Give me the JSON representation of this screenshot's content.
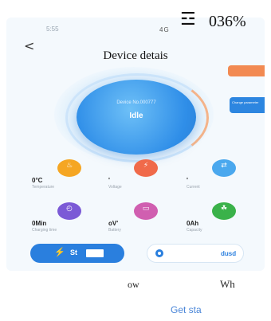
{
  "status": {
    "time": "5:55",
    "signal": "4G",
    "wifi_icon": "☲",
    "battery": "036%"
  },
  "nav": {
    "back": "<",
    "title": "Device   detais"
  },
  "device": {
    "name": "Device No.000777",
    "state": "Idle"
  },
  "side_tags": {
    "change": "Change parameter"
  },
  "metrics": [
    {
      "icon": "thermometer-icon",
      "glyph": "♨",
      "color": "#f5a623",
      "value": "0°C",
      "label": "Temperature"
    },
    {
      "icon": "voltage-icon",
      "glyph": "⚡",
      "color": "#f06a4a",
      "value": "'",
      "label": "Voltage"
    },
    {
      "icon": "current-icon",
      "glyph": "⇄",
      "color": "#4aa8ee",
      "value": "'",
      "label": "Current"
    },
    {
      "icon": "clock-icon",
      "glyph": "◴",
      "color": "#7b5ad6",
      "value": "0Min",
      "label": "Charging time"
    },
    {
      "icon": "battery-icon",
      "glyph": "▭",
      "color": "#d05fb0",
      "value": "oV'",
      "label": "Battery"
    },
    {
      "icon": "leaf-icon",
      "glyph": "☘",
      "color": "#3ab24a",
      "value": "0Ah",
      "label": "Capacity"
    }
  ],
  "buttons": {
    "start": "St",
    "stop": "dusd"
  },
  "readouts": {
    "power": "ow",
    "energy": "Wh"
  },
  "link": "Get  sta"
}
